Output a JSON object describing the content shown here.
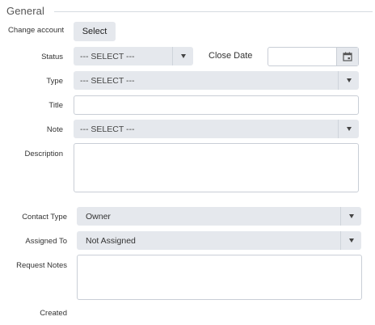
{
  "section": {
    "title": "General"
  },
  "change_account": {
    "label": "Change account",
    "button_label": "Select"
  },
  "status": {
    "label": "Status",
    "value": "--- SELECT ---",
    "icon": "chevron-down-icon"
  },
  "close_date": {
    "label": "Close Date",
    "value": "",
    "icon": "calendar-icon"
  },
  "type": {
    "label": "Type",
    "value": "--- SELECT ---"
  },
  "title": {
    "label": "Title",
    "value": ""
  },
  "note": {
    "label": "Note",
    "value": "--- SELECT ---"
  },
  "description": {
    "label": "Description",
    "value": ""
  },
  "contact_type": {
    "label": "Contact Type",
    "value": "Owner"
  },
  "assigned_to": {
    "label": "Assigned To",
    "value": "Not Assigned"
  },
  "request_notes": {
    "label": "Request Notes",
    "value": ""
  },
  "created": {
    "label": "Created"
  },
  "colors": {
    "select_bg": "#e5e8ed",
    "border": "#c9ced6",
    "text": "#333333"
  }
}
